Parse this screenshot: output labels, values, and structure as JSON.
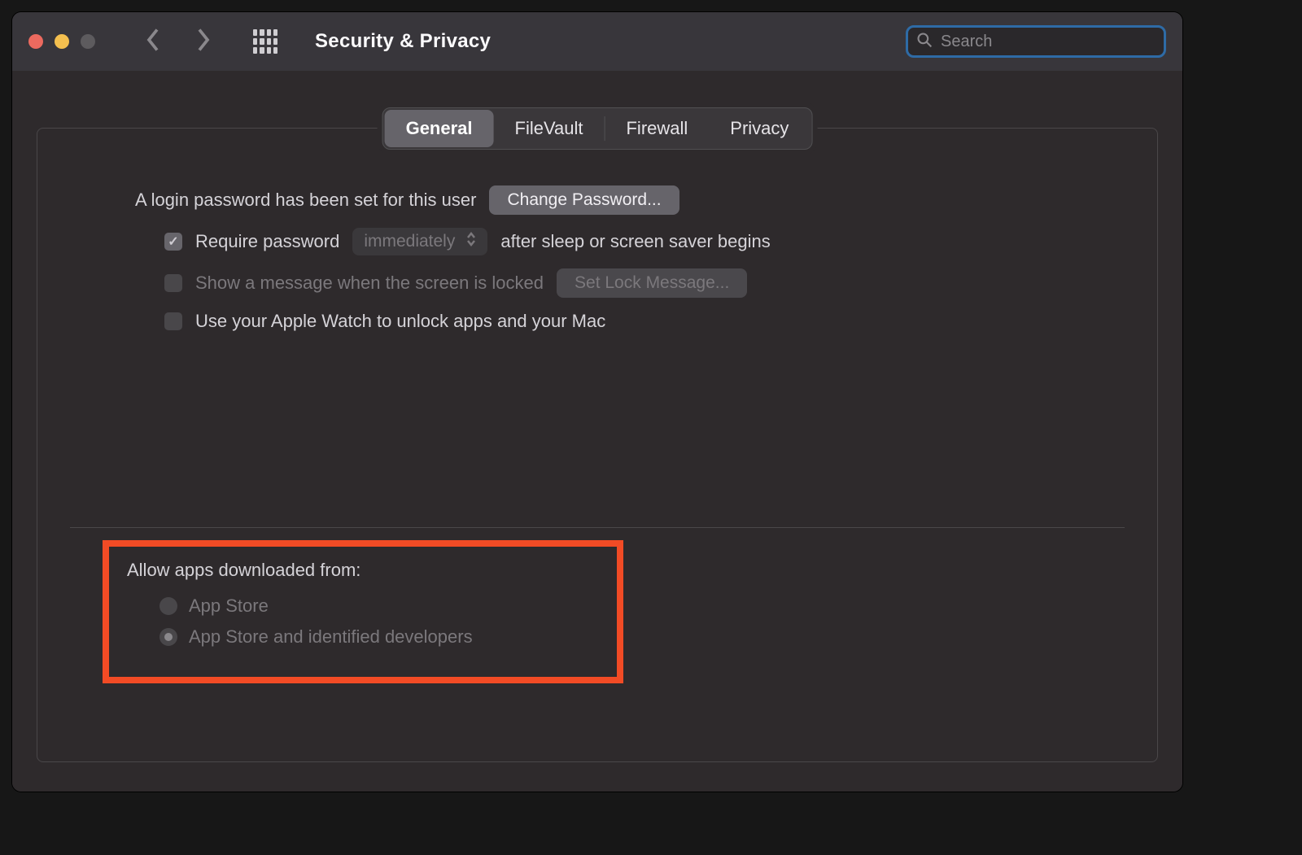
{
  "titlebar": {
    "window_title": "Security & Privacy",
    "search_placeholder": "Search"
  },
  "tabs": {
    "general": "General",
    "filevault": "FileVault",
    "firewall": "Firewall",
    "privacy": "Privacy"
  },
  "general": {
    "login_password_set": "A login password has been set for this user",
    "change_password_btn": "Change Password...",
    "require_password_label": "Require password",
    "require_password_delay": "immediately",
    "after_sleep_label": "after sleep or screen saver begins",
    "show_message_label": "Show a message when the screen is locked",
    "set_lock_message_btn": "Set Lock Message...",
    "apple_watch_label": "Use your Apple Watch to unlock apps and your Mac",
    "allow_apps_title": "Allow apps downloaded from:",
    "allow_option_appstore": "App Store",
    "allow_option_identified": "App Store and identified developers"
  }
}
